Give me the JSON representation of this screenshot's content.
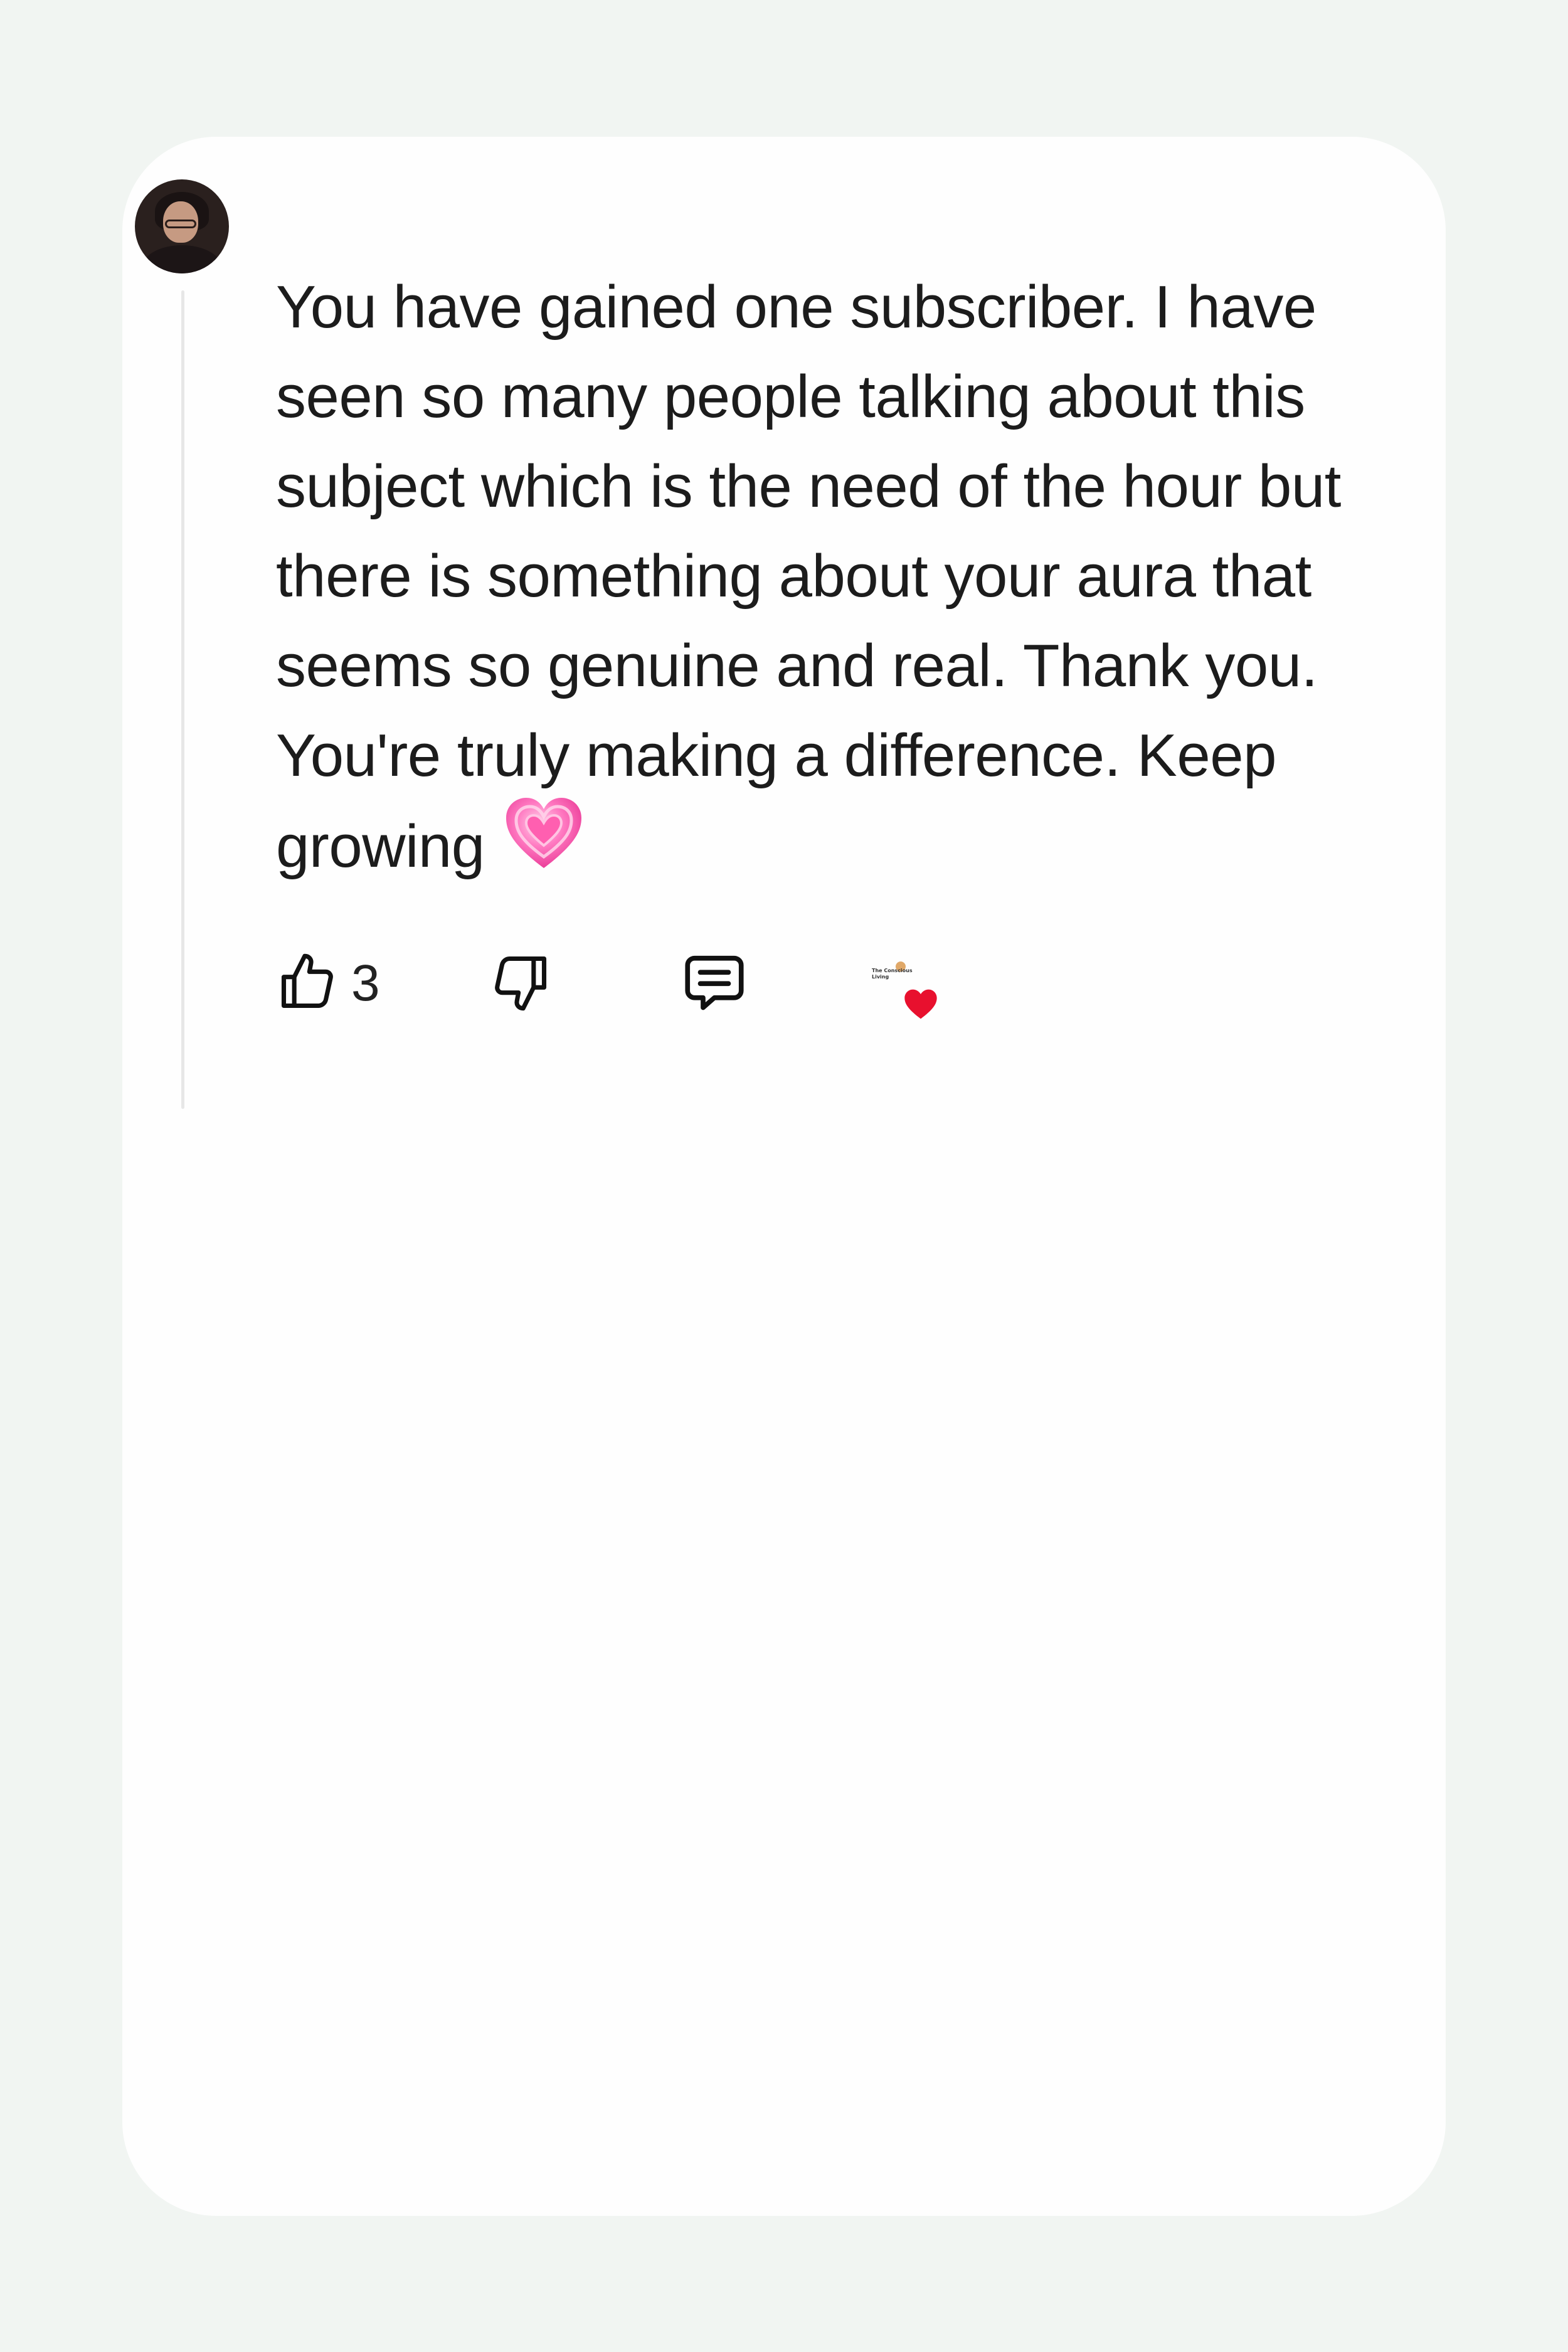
{
  "comment": {
    "author_name": "",
    "lines": [
      "You have gained one subscriber. I have",
      "seen so many people talking about this",
      "subject which is the need of the hour but",
      "there is something about your aura that",
      "seems so genuine and real. Thank you.",
      "You're truly making a difference. Keep",
      "growing"
    ]
  },
  "actions": {
    "like_count": "3",
    "like_icon": "thumbs-up-icon",
    "dislike_icon": "thumbs-down-icon",
    "reply_icon": "reply-comment-icon",
    "creator_heart_icon": "creator-heart-icon",
    "creator_channel_text": "The Conscious Living"
  },
  "colors": {
    "page_background": "#f1f5f2",
    "card_background": "#fefefe",
    "text": "#1c1c1c",
    "creator_heart": "#e8102e",
    "emoji_heart": "#ff4fa8"
  }
}
